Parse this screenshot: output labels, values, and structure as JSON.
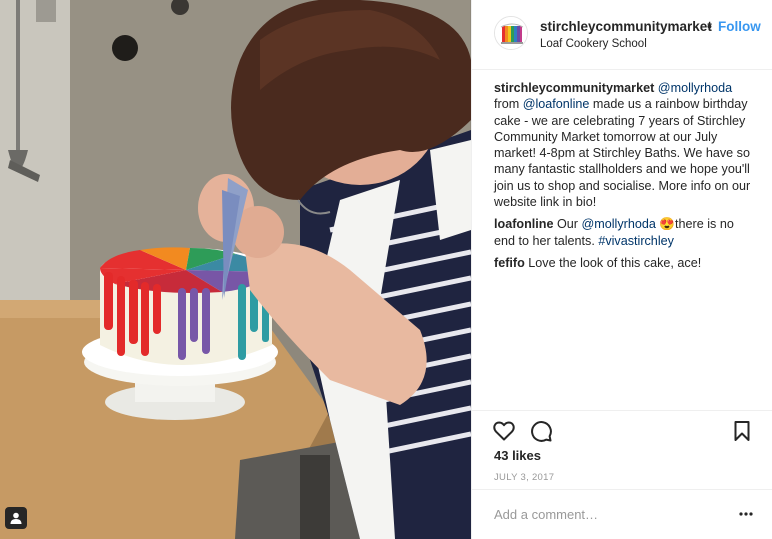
{
  "post": {
    "username": "stirchleycommunitymarket",
    "follow_label": "Follow",
    "separator": "•",
    "location": "Loaf Cookery School",
    "comments": [
      {
        "user": "stirchleycommunitymarket",
        "parts": [
          {
            "t": "link",
            "v": "@mollyrhoda"
          },
          {
            "t": "text",
            "v": " from "
          },
          {
            "t": "link",
            "v": "@loafonline"
          },
          {
            "t": "text",
            "v": " made us a rainbow birthday cake - we are celebrating 7 years of Stirchley Community Market tomorrow at our July market! 4-8pm at Stirchley Baths. We have so many fantastic stallholders and we hope you'll join us to shop and socialise. More info on our website link in bio!"
          }
        ]
      },
      {
        "user": "loafonline",
        "parts": [
          {
            "t": "text",
            "v": "Our "
          },
          {
            "t": "link",
            "v": "@mollyrhoda"
          },
          {
            "t": "text",
            "v": " 😍there is no end to her talents. "
          },
          {
            "t": "link",
            "v": "#vivastirchley"
          }
        ]
      },
      {
        "user": "fefifo",
        "parts": [
          {
            "t": "text",
            "v": "Love the look of this cake, ace!"
          }
        ]
      }
    ],
    "likes": "43 likes",
    "date": "JULY 3, 2017",
    "comment_placeholder": "Add a comment…"
  },
  "icons": {
    "like": "heart-icon",
    "comment": "comment-bubble-icon",
    "save": "bookmark-icon",
    "more": "more-options-icon",
    "tag": "user-tag-icon"
  },
  "colors": {
    "link": "#003569",
    "follow": "#3897f0",
    "text": "#262626",
    "muted": "#999999",
    "border": "#efefef"
  }
}
